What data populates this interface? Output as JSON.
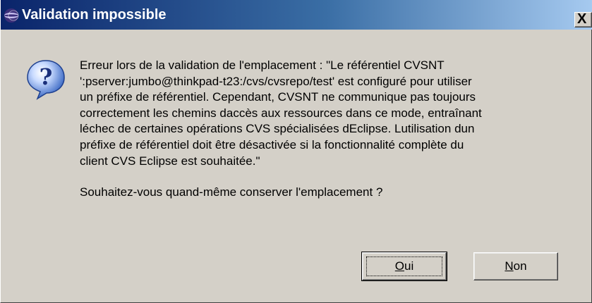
{
  "window": {
    "title": "Validation impossible",
    "close_glyph": "X",
    "app_icon": "eclipse-icon"
  },
  "message": {
    "icon": "question-icon",
    "lines": [
      "Erreur lors de la validation de l'emplacement : \"Le référentiel CVSNT",
      "':pserver:jumbo@thinkpad-t23:/cvs/cvsrepo/test' est configuré pour utiliser",
      "un préfixe de référentiel. Cependant, CVSNT ne communique pas toujours",
      "correctement les chemins daccès aux ressources dans ce mode, entraînant",
      "léchec de certaines opérations CVS spécialisées dEclipse. Lutilisation dun",
      "préfixe de référentiel doit être désactivée si la fonctionnalité complète du",
      "client CVS Eclipse est souhaitée.\""
    ],
    "question": "Souhaitez-vous quand-même conserver l'emplacement ?"
  },
  "buttons": {
    "yes_mnemonic": "O",
    "yes_rest": "ui",
    "no_mnemonic": "N",
    "no_rest": "on"
  },
  "colors": {
    "dialog_bg": "#d4d0c8",
    "titlebar_start": "#0a246a",
    "titlebar_end": "#a6caf0",
    "question_icon": "#2f5fbf"
  }
}
